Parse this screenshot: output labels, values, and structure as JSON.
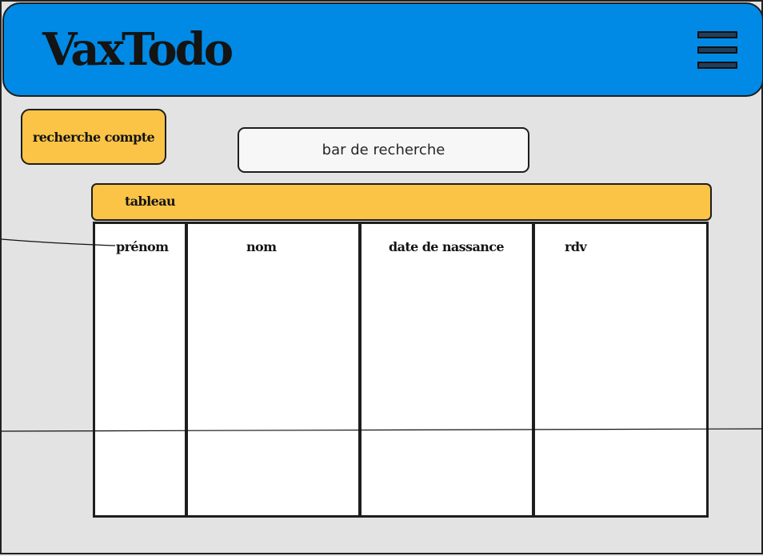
{
  "header": {
    "title": "VaxTodo",
    "menu_icon": "hamburger-menu-icon"
  },
  "toolbar": {
    "account_search_label": "recherche compte",
    "search_placeholder": "bar de recherche"
  },
  "table": {
    "title": "tableau",
    "columns": [
      "prénom",
      "nom",
      "date de nassance",
      "rdv"
    ]
  },
  "colors": {
    "header_blue": "#008ae6",
    "accent_yellow": "#fcc447",
    "background": "#e3e3e3",
    "outline": "#1e1e1e"
  }
}
